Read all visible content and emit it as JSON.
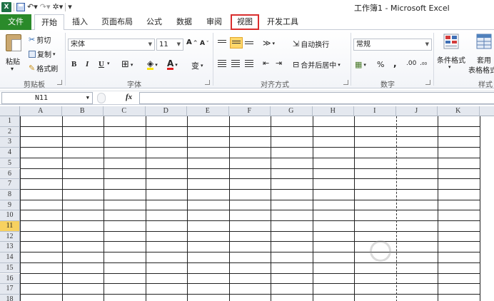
{
  "window": {
    "title": "工作簿1 - Microsoft Excel",
    "app_logo": "X"
  },
  "quick_access": {
    "icons": [
      "excel-logo",
      "save-icon",
      "undo-icon",
      "redo-icon",
      "customize-icon"
    ]
  },
  "tabs": [
    {
      "label": "文件",
      "state": "file"
    },
    {
      "label": "开始",
      "state": "active"
    },
    {
      "label": "插入",
      "state": ""
    },
    {
      "label": "页面布局",
      "state": ""
    },
    {
      "label": "公式",
      "state": ""
    },
    {
      "label": "数据",
      "state": ""
    },
    {
      "label": "审阅",
      "state": ""
    },
    {
      "label": "视图",
      "state": "highlighted"
    },
    {
      "label": "开发工具",
      "state": ""
    }
  ],
  "ribbon": {
    "clipboard": {
      "paste": "粘贴",
      "cut": "剪切",
      "copy": "复制",
      "format_painter": "格式刷",
      "group_label": "剪贴板"
    },
    "font": {
      "font_name": "宋体",
      "font_size": "11",
      "bold": "B",
      "italic": "I",
      "underline": "U",
      "grow": "A",
      "shrink": "A",
      "phonetic": "变",
      "group_label": "字体"
    },
    "alignment": {
      "wrap_text": "自动换行",
      "merge_center": "合并后居中",
      "group_label": "对齐方式"
    },
    "number": {
      "format": "常规",
      "percent": "%",
      "comma": ",",
      "increase_decimal": ".00",
      "group_label": "数字"
    },
    "styles": {
      "conditional": "条件格式",
      "table_format_top": "套用",
      "table_format_bottom": "表格格式",
      "group_label": "样式"
    }
  },
  "formula_bar": {
    "name_box": "N11",
    "fx": "fx",
    "formula": ""
  },
  "sheet": {
    "columns": [
      "A",
      "B",
      "C",
      "D",
      "E",
      "F",
      "G",
      "H",
      "I",
      "J",
      "K"
    ],
    "rows": [
      "1",
      "2",
      "3",
      "4",
      "5",
      "6",
      "7",
      "8",
      "9",
      "10",
      "11",
      "12",
      "13",
      "14",
      "15",
      "16",
      "17",
      "18"
    ],
    "selected_row": "11"
  },
  "colors": {
    "file_tab": "#2a8a2a",
    "highlight_box": "#d92e2e",
    "selected_row_header": "#f7d160"
  }
}
